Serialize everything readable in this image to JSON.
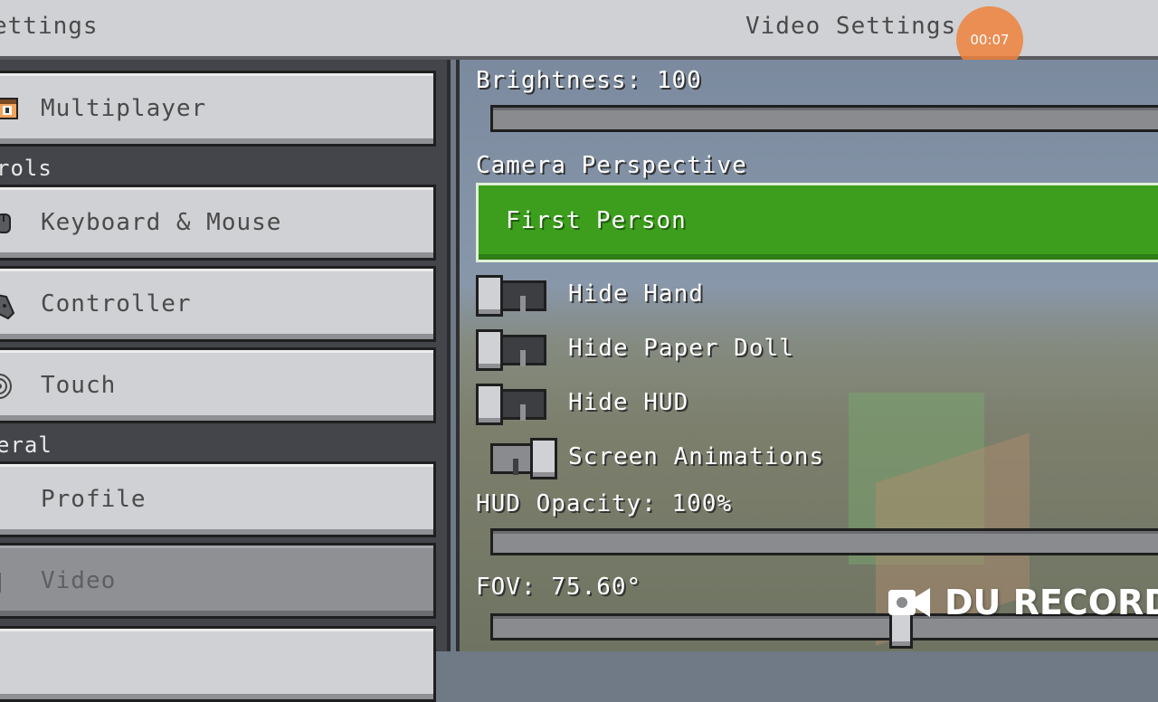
{
  "header": {
    "left_title": "ettings",
    "title": "Video Settings",
    "timer": "00:07"
  },
  "sidebar": {
    "multiplayer": "Multiplayer",
    "section_controls": "rols",
    "keyboard_mouse": "Keyboard & Mouse",
    "controller": "Controller",
    "touch": "Touch",
    "section_general": "eral",
    "profile": "Profile",
    "video": "Video",
    "selected": "Video"
  },
  "video": {
    "brightness_label": "Brightness: 100",
    "brightness_value": 100,
    "camera_label": "Camera Perspective",
    "camera_value": "First Person",
    "hide_hand": {
      "label": "Hide Hand",
      "on": false
    },
    "hide_paper_doll": {
      "label": "Hide Paper Doll",
      "on": false
    },
    "hide_hud": {
      "label": "Hide HUD",
      "on": false
    },
    "screen_animations": {
      "label": "Screen Animations",
      "on": true
    },
    "hud_opacity_label": "HUD Opacity: 100%",
    "hud_opacity_value": 100,
    "fov_label": "FOV: 75.60°",
    "fov_value": 75.6
  },
  "watermark": "DU RECORDI",
  "colors": {
    "accent_green": "#3c9e1c",
    "timer_orange": "#ef833c",
    "button_gray": "#d0d1d4"
  },
  "icons": {
    "multiplayer": "player-face-icon",
    "keyboard_mouse": "mouse-icon",
    "controller": "controller-icon",
    "touch": "touch-icon",
    "recorder": "video-camera-icon"
  }
}
